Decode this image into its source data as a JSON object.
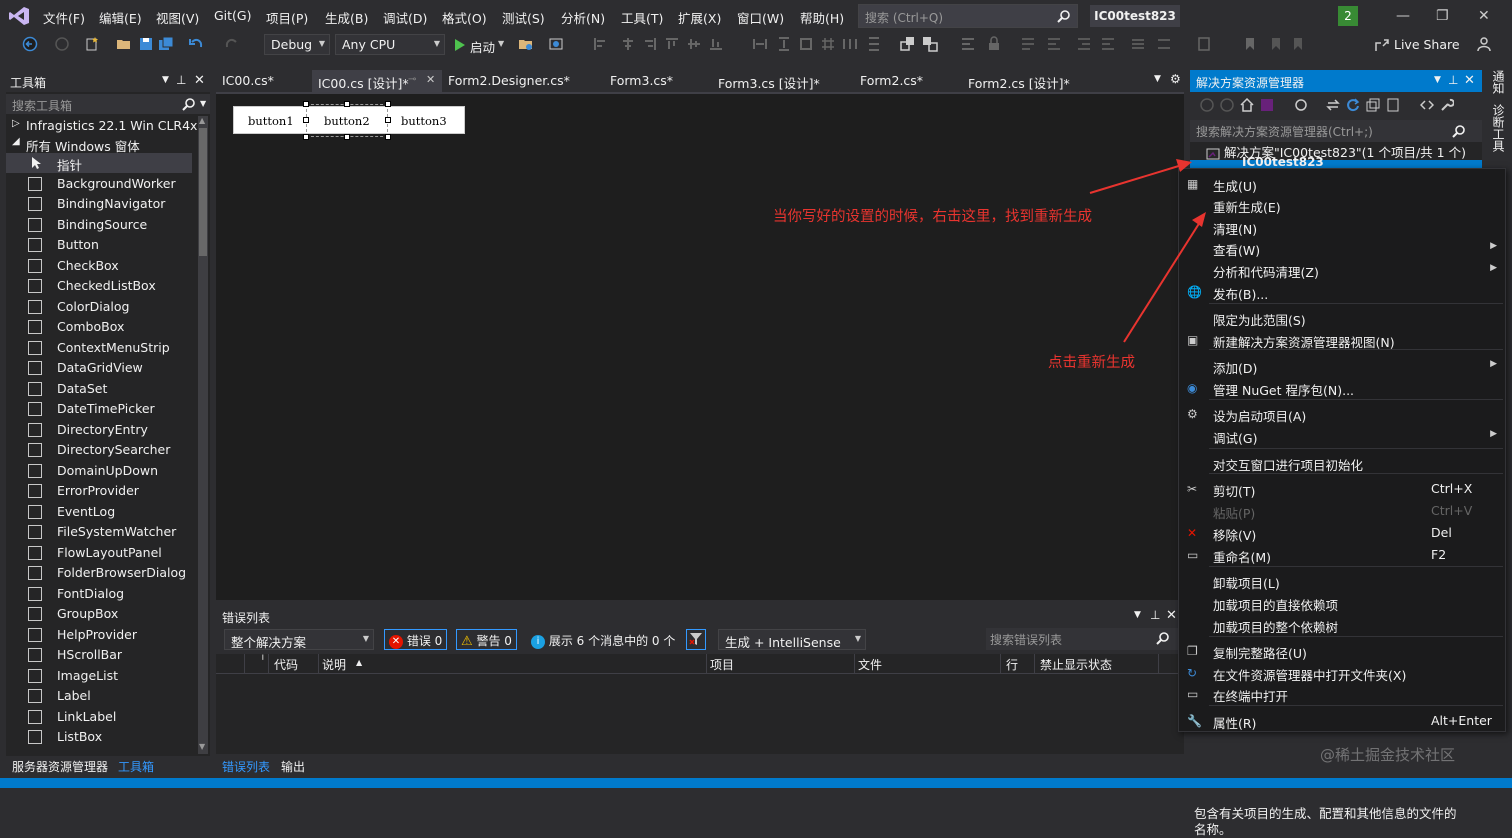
{
  "menubar": {
    "items": [
      "文件(F)",
      "编辑(E)",
      "视图(V)",
      "Git(G)",
      "项目(P)",
      "生成(B)",
      "调试(D)",
      "格式(O)",
      "测试(S)",
      "分析(N)",
      "工具(T)",
      "扩展(X)",
      "窗口(W)",
      "帮助(H)"
    ],
    "search_placeholder": "搜索 (Ctrl+Q)",
    "project_title": "IC00test823",
    "notification_count": "2"
  },
  "toolbar": {
    "config": "Debug",
    "platform": "Any CPU",
    "start_label": "启动",
    "live_share": "Live Share"
  },
  "toolbox": {
    "title": "工具箱",
    "search_placeholder": "搜索工具箱",
    "groups": [
      "Infragistics 22.1 Win CLR4x",
      "所有 Windows 窗体"
    ],
    "items": [
      "指针",
      "BackgroundWorker",
      "BindingNavigator",
      "BindingSource",
      "Button",
      "CheckBox",
      "CheckedListBox",
      "ColorDialog",
      "ComboBox",
      "ContextMenuStrip",
      "DataGridView",
      "DataSet",
      "DateTimePicker",
      "DirectoryEntry",
      "DirectorySearcher",
      "DomainUpDown",
      "ErrorProvider",
      "EventLog",
      "FileSystemWatcher",
      "FlowLayoutPanel",
      "FolderBrowserDialog",
      "FontDialog",
      "GroupBox",
      "HelpProvider",
      "HScrollBar",
      "ImageList",
      "Label",
      "LinkLabel",
      "ListBox"
    ]
  },
  "doc_tabs": [
    "IC00.cs*",
    "IC00.cs [设计]*",
    "Form2.Designer.cs*",
    "Form3.cs*",
    "Form3.cs [设计]*",
    "Form2.cs*",
    "Form2.cs [设计]*"
  ],
  "designer": {
    "buttons": [
      "button1",
      "button2",
      "button3"
    ]
  },
  "error_list": {
    "title": "错误列表",
    "scope": "整个解决方案",
    "errors": "错误 0",
    "warnings": "警告 0",
    "messages": "展示 6 个消息中的 0 个",
    "build_filter": "生成 + IntelliSense",
    "search_placeholder": "搜索错误列表",
    "columns": [
      "代码",
      "说明",
      "项目",
      "文件",
      "行",
      "禁止显示状态"
    ]
  },
  "bottom_tabs": {
    "left": [
      "服务器资源管理器",
      "工具箱"
    ],
    "center": [
      "错误列表",
      "输出"
    ]
  },
  "solution_explorer": {
    "title": "解决方案资源管理器",
    "search_placeholder": "搜索解决方案资源管理器(Ctrl+;)",
    "solution_label": "解决方案\"IC00test823\"(1 个项目/共 1 个)",
    "project_label": "IC00test823",
    "properties_desc": "包含有关项目的生成、配置和其他信息的文件的名称。"
  },
  "right_strip": [
    "通知",
    "诊断工具"
  ],
  "context_menu": [
    {
      "label": "生成(U)",
      "icon": "build-icon"
    },
    {
      "label": "重新生成(E)"
    },
    {
      "label": "清理(N)"
    },
    {
      "label": "查看(W)",
      "submenu": true
    },
    {
      "label": "分析和代码清理(Z)",
      "submenu": true
    },
    {
      "label": "发布(B)...",
      "icon": "globe-icon"
    },
    {
      "label": "限定为此范围(S)"
    },
    {
      "label": "新建解决方案资源管理器视图(N)",
      "icon": "new-view-icon"
    },
    {
      "label": "添加(D)",
      "submenu": true
    },
    {
      "label": "管理 NuGet 程序包(N)...",
      "icon": "nuget-icon"
    },
    {
      "label": "设为启动项目(A)",
      "icon": "gear-icon"
    },
    {
      "label": "调试(G)",
      "submenu": true
    },
    {
      "label": "对交互窗口进行项目初始化"
    },
    {
      "label": "剪切(T)",
      "shortcut": "Ctrl+X",
      "icon": "cut-icon"
    },
    {
      "label": "粘贴(P)",
      "shortcut": "Ctrl+V",
      "disabled": true
    },
    {
      "label": "移除(V)",
      "shortcut": "Del",
      "icon": "remove-icon"
    },
    {
      "label": "重命名(M)",
      "shortcut": "F2",
      "icon": "rename-icon"
    },
    {
      "label": "卸载项目(L)"
    },
    {
      "label": "加载项目的直接依赖项"
    },
    {
      "label": "加载项目的整个依赖树"
    },
    {
      "label": "复制完整路径(U)",
      "icon": "copy-icon"
    },
    {
      "label": "在文件资源管理器中打开文件夹(X)",
      "icon": "open-folder-icon"
    },
    {
      "label": "在终端中打开",
      "icon": "terminal-icon"
    },
    {
      "label": "属性(R)",
      "shortcut": "Alt+Enter",
      "icon": "wrench-icon"
    }
  ],
  "annotations": {
    "first": "当你写好的设置的时候，右击这里，找到重新生成",
    "second": "点击重新生成",
    "color": "#e8342f"
  },
  "watermark": "@稀土掘金技术社区"
}
